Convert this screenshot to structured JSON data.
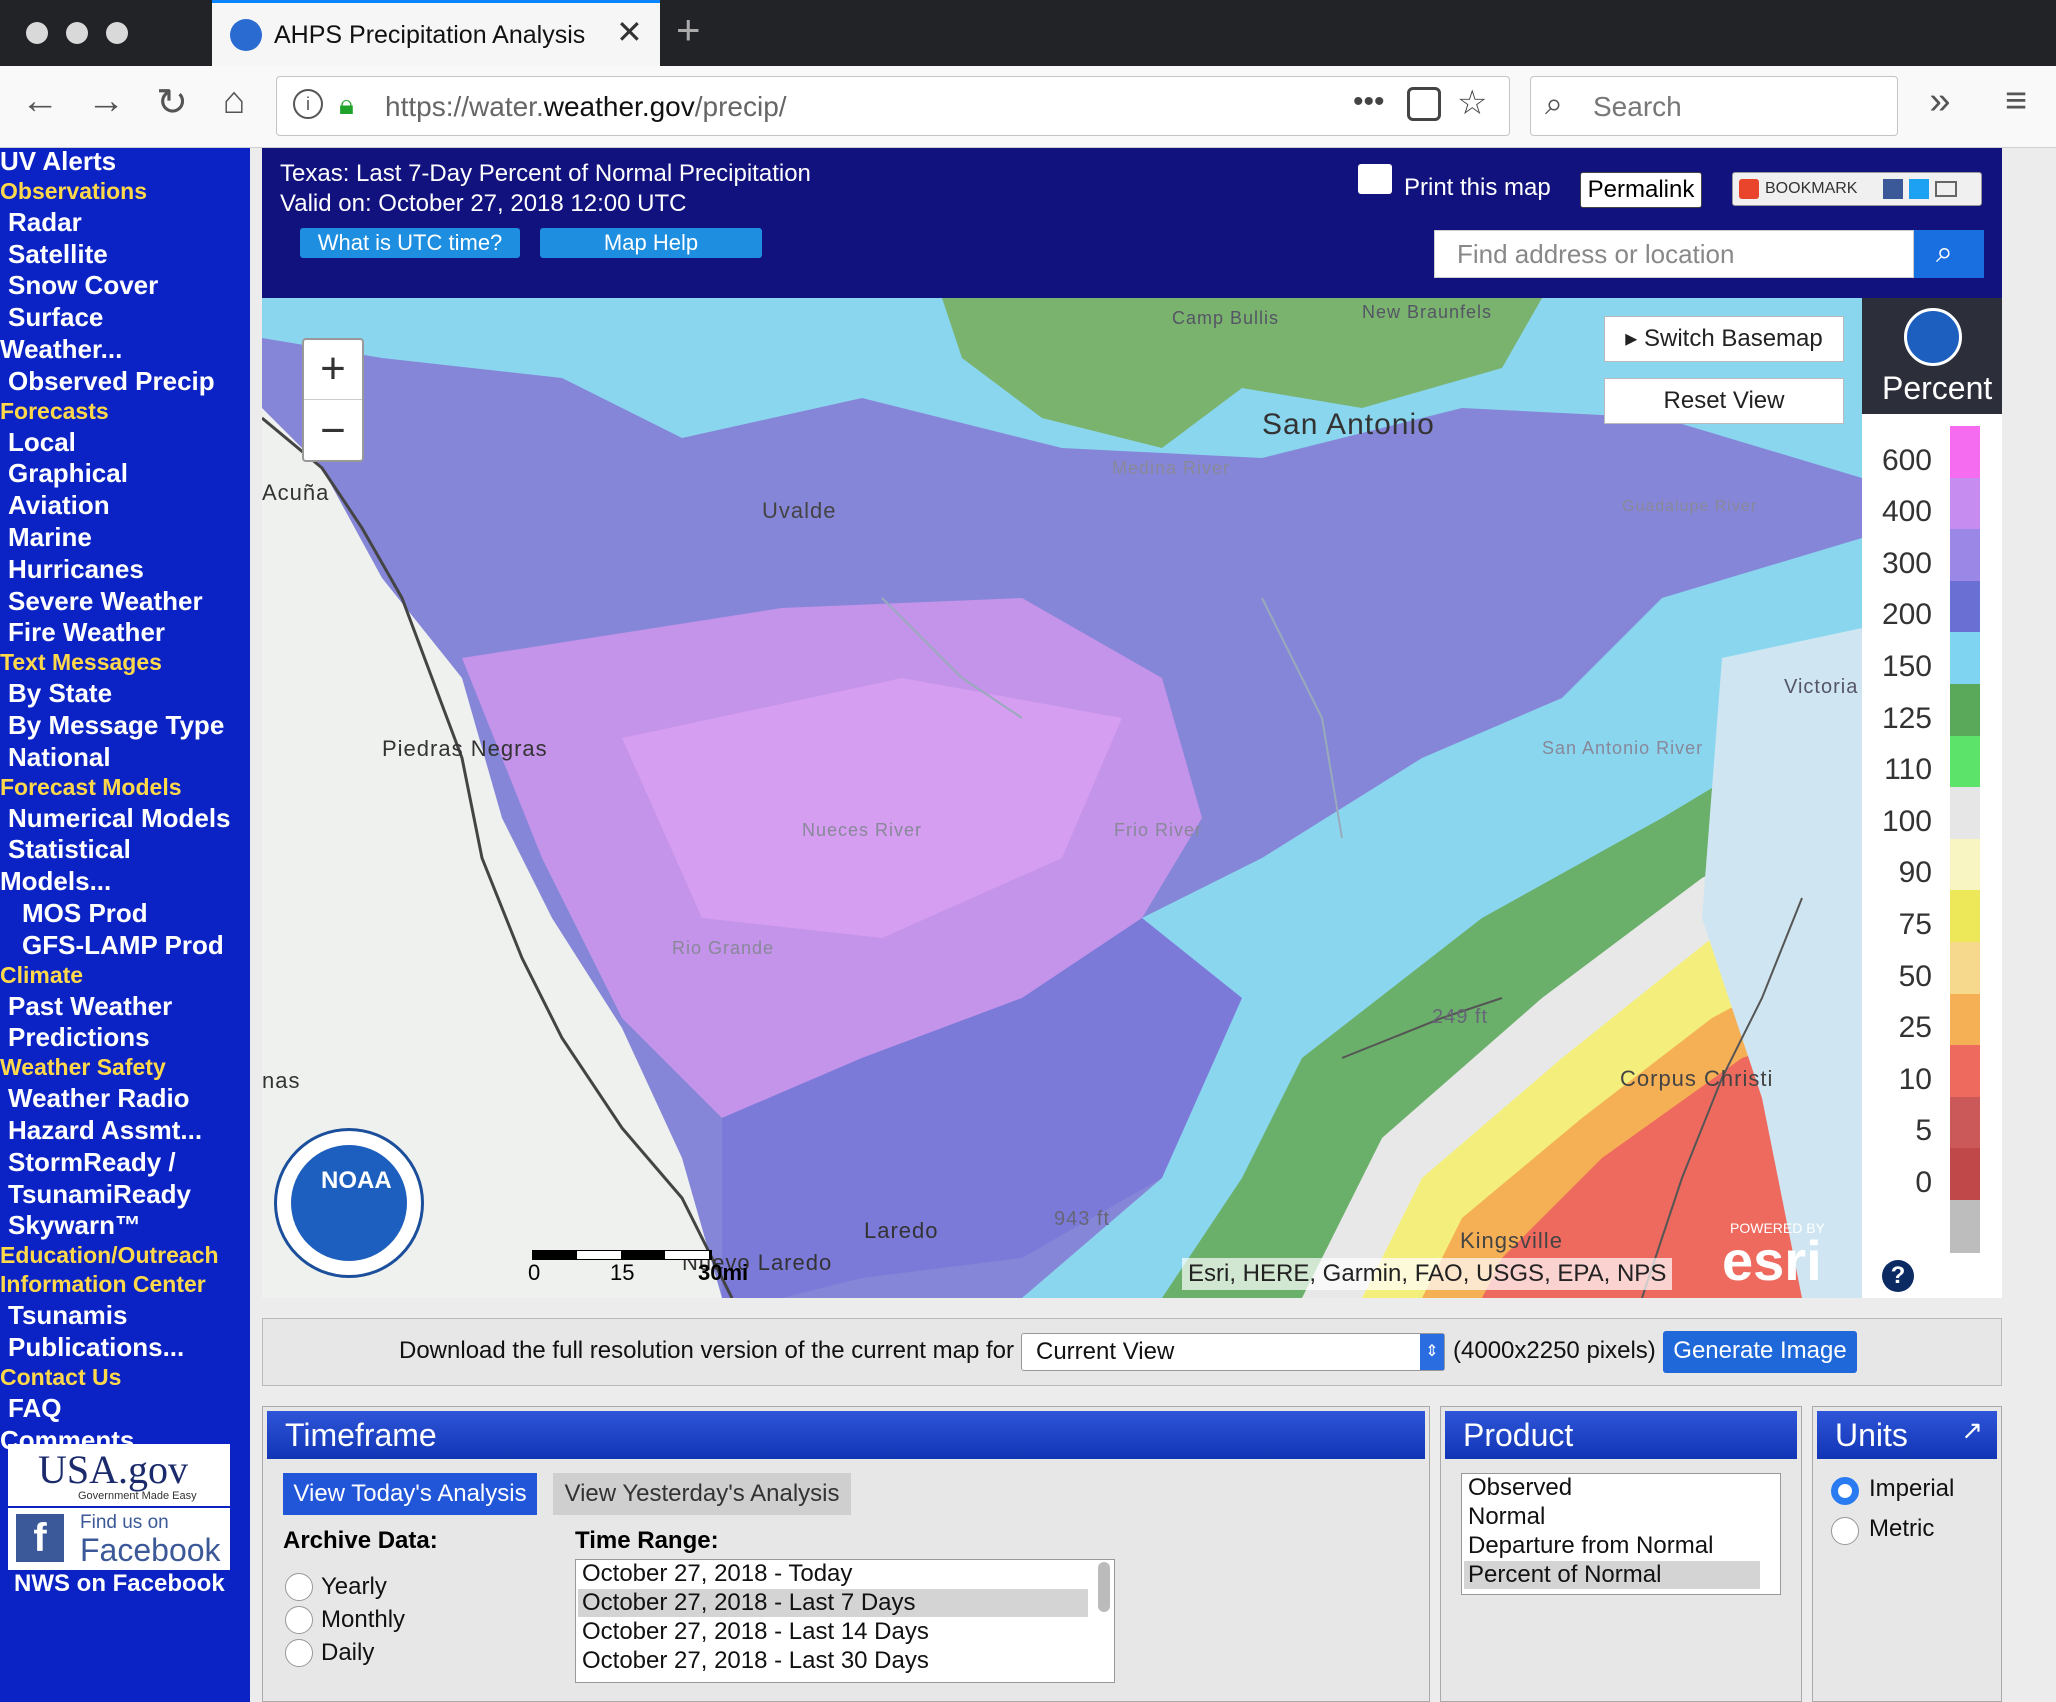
{
  "browser": {
    "tab_title": "AHPS Precipitation Analysis",
    "url_prefix": "https://water.",
    "url_domain": "weather.gov",
    "url_path": "/precip/",
    "search_placeholder": "Search",
    "more": "•••"
  },
  "sidebar": {
    "items": [
      {
        "type": "item",
        "label": "UV Alerts"
      },
      {
        "type": "heading",
        "label": "Observations"
      },
      {
        "type": "item",
        "label": "Radar"
      },
      {
        "type": "item",
        "label": "Satellite"
      },
      {
        "type": "item",
        "label": "Snow Cover"
      },
      {
        "type": "item",
        "label": "Surface"
      },
      {
        "type": "item",
        "label": "Weather..."
      },
      {
        "type": "item",
        "label": "Observed Precip"
      },
      {
        "type": "heading",
        "label": "Forecasts"
      },
      {
        "type": "item",
        "label": "Local"
      },
      {
        "type": "item",
        "label": "Graphical"
      },
      {
        "type": "item",
        "label": "Aviation"
      },
      {
        "type": "item",
        "label": "Marine"
      },
      {
        "type": "item",
        "label": "Hurricanes"
      },
      {
        "type": "item",
        "label": "Severe Weather"
      },
      {
        "type": "item",
        "label": "Fire Weather"
      },
      {
        "type": "heading",
        "label": "Text Messages"
      },
      {
        "type": "item",
        "label": "By State"
      },
      {
        "type": "item",
        "label": "By Message Type"
      },
      {
        "type": "item",
        "label": "National"
      },
      {
        "type": "heading",
        "label": "Forecast Models"
      },
      {
        "type": "item",
        "label": "Numerical Models"
      },
      {
        "type": "item",
        "label": "Statistical"
      },
      {
        "type": "item",
        "label": "Models..."
      },
      {
        "type": "item",
        "label": "MOS Prod"
      },
      {
        "type": "item",
        "label": "GFS-LAMP Prod"
      },
      {
        "type": "heading",
        "label": "Climate"
      },
      {
        "type": "item",
        "label": "Past Weather"
      },
      {
        "type": "item",
        "label": "Predictions"
      },
      {
        "type": "heading",
        "label": "Weather Safety"
      },
      {
        "type": "item",
        "label": "Weather Radio"
      },
      {
        "type": "item",
        "label": "Hazard Assmt..."
      },
      {
        "type": "item",
        "label": "StormReady /"
      },
      {
        "type": "item",
        "label": "TsunamiReady"
      },
      {
        "type": "item",
        "label": "Skywarn™"
      },
      {
        "type": "heading",
        "label": "Education/Outreach"
      },
      {
        "type": "heading",
        "label": "Information Center"
      },
      {
        "type": "item",
        "label": "Tsunamis"
      },
      {
        "type": "item",
        "label": "Publications..."
      },
      {
        "type": "heading",
        "label": "Contact Us"
      },
      {
        "type": "item",
        "label": "FAQ"
      },
      {
        "type": "item",
        "label": "Comments..."
      }
    ],
    "usagov": "USA.gov",
    "usagov_tag": "Government Made Easy",
    "fb_find": "Find us on",
    "fb_name": "Facebook",
    "nws_fb": "NWS on Facebook"
  },
  "header": {
    "title": "Texas: Last 7-Day Percent of Normal Precipitation",
    "valid": "Valid on: October 27, 2018 12:00 UTC",
    "utc_btn": "What is UTC time?",
    "help_btn": "Map Help",
    "print": "Print this map",
    "permalink": "Permalink",
    "bookmark": "BOOKMARK",
    "find_placeholder": "Find address or location"
  },
  "map": {
    "switch_basemap": "Switch Basemap",
    "reset_view": "Reset View",
    "zoom_in": "+",
    "zoom_out": "−",
    "legend_title": "Percent",
    "noaa": "NOAA",
    "attribution": "Esri, HERE, Garmin, FAO, USGS, EPA, NPS",
    "powered_by": "POWERED BY",
    "esri": "esri",
    "help": "?",
    "scale_labels": [
      "0",
      "15",
      "30mi"
    ],
    "places": [
      "San Antonio",
      "Uvalde",
      "Acuña",
      "Piedras Negras",
      "Laredo",
      "Nuevo Laredo",
      "Corpus Christi",
      "Kingsville",
      "Victoria",
      "Camp Bullis",
      "New Braunfels",
      "Medina River",
      "Nueces River",
      "Frio River",
      "San Antonio River",
      "Guadalupe River",
      "Rio Grande",
      "249 ft",
      "943 ft",
      "nas"
    ],
    "legend_ticks": [
      "600",
      "400",
      "300",
      "200",
      "150",
      "125",
      "110",
      "100",
      "90",
      "75",
      "50",
      "25",
      "10",
      "5",
      "0"
    ],
    "legend_colors": [
      "#f66cf0",
      "#c68cef",
      "#9b88e6",
      "#6a6fd3",
      "#7fd4f2",
      "#5aa85a",
      "#5ce46a",
      "#e6e6e6",
      "#f8f5c3",
      "#ece85a",
      "#f6d98c",
      "#f5b055",
      "#ee6a5e",
      "#cc5959",
      "#c04848",
      "#bdbdbd"
    ]
  },
  "download": {
    "label": "Download the full resolution version of the current map for",
    "select": "Current View",
    "size": "(4000x2250 pixels)",
    "button": "Generate Image"
  },
  "timeframe": {
    "title": "Timeframe",
    "today_btn": "View Today's Analysis",
    "yesterday_btn": "View Yesterday's Analysis",
    "archive_label": "Archive Data:",
    "archive_options": [
      "Yearly",
      "Monthly",
      "Daily"
    ],
    "range_label": "Time Range:",
    "ranges": [
      "October 27, 2018 - Today",
      "October 27, 2018 - Last 7 Days",
      "October 27, 2018 - Last 14 Days",
      "October 27, 2018 - Last 30 Days"
    ],
    "selected_range": 1
  },
  "product": {
    "title": "Product",
    "options": [
      "Observed",
      "Normal",
      "Departure from Normal",
      "Percent of Normal"
    ],
    "selected": 3
  },
  "units": {
    "title": "Units",
    "options": [
      "Imperial",
      "Metric"
    ],
    "selected": 0
  }
}
